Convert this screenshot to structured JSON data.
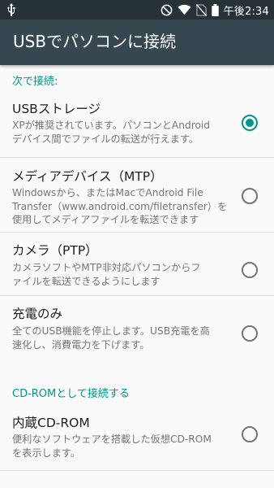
{
  "status_bar": {
    "time": "午後2:34",
    "icons": [
      "usb-icon",
      "do-not-disturb-icon",
      "wifi-icon",
      "no-sim-icon",
      "battery-icon"
    ]
  },
  "app_bar": {
    "title": "USBでパソコンに接続"
  },
  "sections": [
    {
      "header": "次で接続:",
      "items": [
        {
          "title": "USBストレージ",
          "desc": [
            "XPが推奨されています。パソコンとAndroid",
            "デバイス間でファイルの転送が行えます。"
          ],
          "checked": true
        },
        {
          "title": "メディアデバイス（MTP）",
          "desc": [
            "Windowsから、またはMacでAndroid File",
            "Transfer（www.android.com/filetransfer）を",
            "使用してメディアファイルを転送できます"
          ],
          "checked": false
        },
        {
          "title": "カメラ（PTP）",
          "desc": [
            "カメラソフトやMTP非対応パソコンからフ",
            "ァイルを転送できるようにします"
          ],
          "checked": false
        },
        {
          "title": "充電のみ",
          "desc": [
            "全てのUSB機能を停止します。USB充電を高",
            "速化し、消費電力を下げます。"
          ],
          "checked": false
        }
      ]
    },
    {
      "header": "CD-ROMとして接続する",
      "items": [
        {
          "title": "内蔵CD-ROM",
          "desc": [
            "便利なソフトウェアを搭載した仮想CD-ROM",
            "を表示します。"
          ],
          "checked": false
        }
      ]
    }
  ],
  "colors": {
    "status_bar": "#263238",
    "app_bar": "#37474f",
    "accent": "#009688",
    "background": "#fafafa"
  }
}
